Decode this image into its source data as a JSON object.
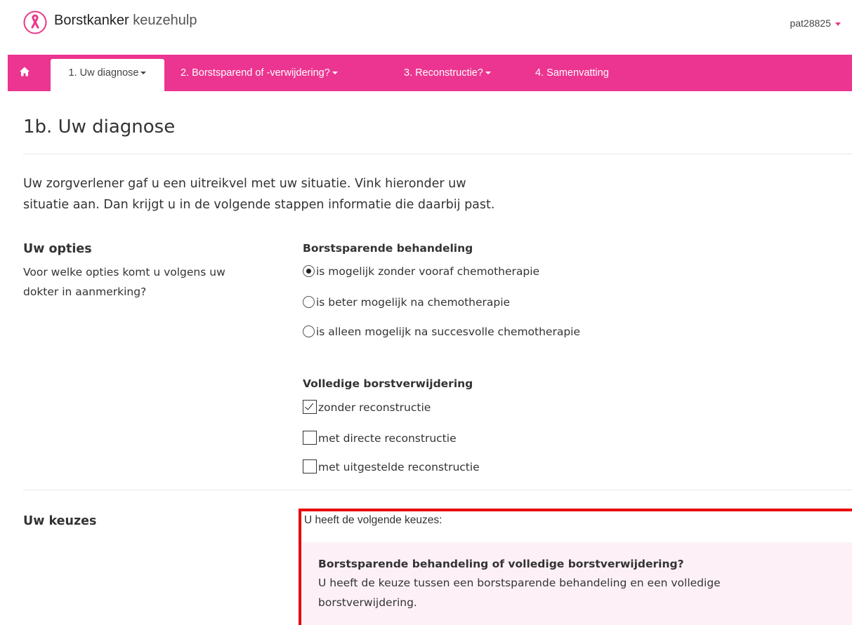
{
  "header": {
    "brand_bold": "Borstkanker",
    "brand_light": "keuzehulp",
    "user": "pat28825",
    "colors": {
      "accent": "#ec3591",
      "ribbon": "#e8388b"
    }
  },
  "nav": {
    "home_icon": "home-icon",
    "tabs": [
      {
        "label": "1. Uw diagnose"
      },
      {
        "label": "2. Borstsparend of -verwijdering?"
      },
      {
        "label": "3. Reconstructie?"
      },
      {
        "label": "4. Samenvatting"
      }
    ]
  },
  "page": {
    "title": "1b. Uw diagnose",
    "intro_line1": "Uw zorgverlener gaf u een uitreikvel met uw situatie. Vink hieronder uw",
    "intro_line2": "situatie aan. Dan krijgt u in de volgende stappen informatie die daarbij past."
  },
  "options": {
    "heading": "Uw opties",
    "question_line1": "Voor welke opties komt u volgens uw",
    "question_line2": "dokter in aanmerking?",
    "breast_conserving": {
      "title": "Borstsparende behandeling",
      "radios": [
        {
          "label": "is mogelijk zonder vooraf chemotherapie",
          "selected": true
        },
        {
          "label": "is beter mogelijk na chemotherapie",
          "selected": false
        },
        {
          "label": "is alleen mogelijk na succesvolle chemotherapie",
          "selected": false
        }
      ]
    },
    "mastectomy": {
      "title": "Volledige borstverwijdering",
      "checkboxes": [
        {
          "label": "zonder reconstructie",
          "checked": true
        },
        {
          "label": "met directe reconstructie",
          "checked": false
        },
        {
          "label": "met uitgestelde reconstructie",
          "checked": false
        }
      ]
    }
  },
  "choices": {
    "heading": "Uw keuzes",
    "intro": "U heeft de volgende keuzes:",
    "card_title": "Borstsparende behandeling of volledige borstverwijdering?",
    "card_text_line1": "U heeft de keuze tussen een borstsparende behandeling en een volledige",
    "card_text_line2": "borstverwijdering."
  }
}
